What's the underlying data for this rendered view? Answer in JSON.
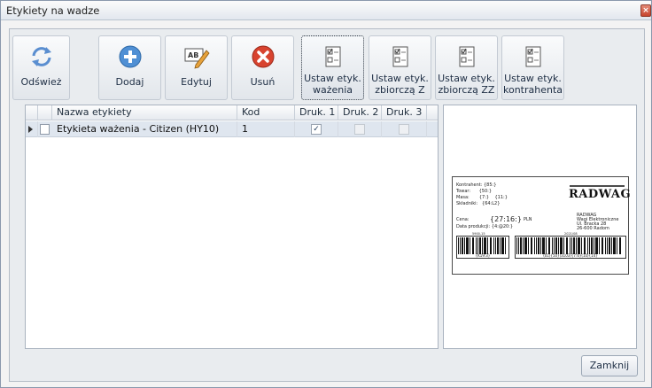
{
  "window": {
    "title": "Etykiety na wadze",
    "close_symbol": "×"
  },
  "toolbar": {
    "buttons": [
      {
        "label": "Odśwież",
        "icon": "refresh-icon"
      },
      {
        "label": "Dodaj",
        "icon": "plus-circle-icon"
      },
      {
        "label": "Edytuj",
        "icon": "edit-ab-icon"
      },
      {
        "label": "Usuń",
        "icon": "delete-x-icon"
      },
      {
        "label_line1": "Ustaw etyk.",
        "label_line2": "ważenia",
        "icon": "checklist-icon"
      },
      {
        "label_line1": "Ustaw etyk.",
        "label_line2": "zbiorczą Z",
        "icon": "checklist-icon"
      },
      {
        "label_line1": "Ustaw etyk.",
        "label_line2": "zbiorczą ZZ",
        "icon": "checklist-icon"
      },
      {
        "label_line1": "Ustaw etyk.",
        "label_line2": "kontrahenta",
        "icon": "checklist-icon"
      }
    ]
  },
  "grid": {
    "columns": [
      "Nazwa etykiety",
      "Kod",
      "Druk. 1",
      "Druk. 2",
      "Druk. 3"
    ],
    "rows": [
      {
        "name": "Etykieta ważenia - Citizen (HY10)",
        "code": "1",
        "druk1": true,
        "druk2": false,
        "druk3": false
      }
    ]
  },
  "preview": {
    "left_fields": [
      {
        "label": "Kontrahent:",
        "value": "{85:}"
      },
      {
        "label": "Towar:",
        "value": "{50:}"
      },
      {
        "label": "Masa:",
        "value": "{7:}",
        "extra": "{11:}"
      },
      {
        "label": "Składniki:",
        "value": "{64:L2}"
      }
    ],
    "brand": "RADWAG",
    "cena_label": "Cena:",
    "cena_value": "{27:16:}",
    "currency": "PLN",
    "data_label": "Data produkcji:",
    "data_value": "{4:@20:}",
    "company_lines": [
      "RADWAG",
      "Wagi Elektroniczne",
      "Ul. Bracka 28",
      "26-600 Radom"
    ],
    "barcode1_top": "5900-15",
    "barcode1_text": "{K19:3}",
    "barcode2_top": "2021/08",
    "barcode2_text": "(01){50}(3103){7:6}(10){14}"
  },
  "footer": {
    "close_label": "Zamknij"
  }
}
